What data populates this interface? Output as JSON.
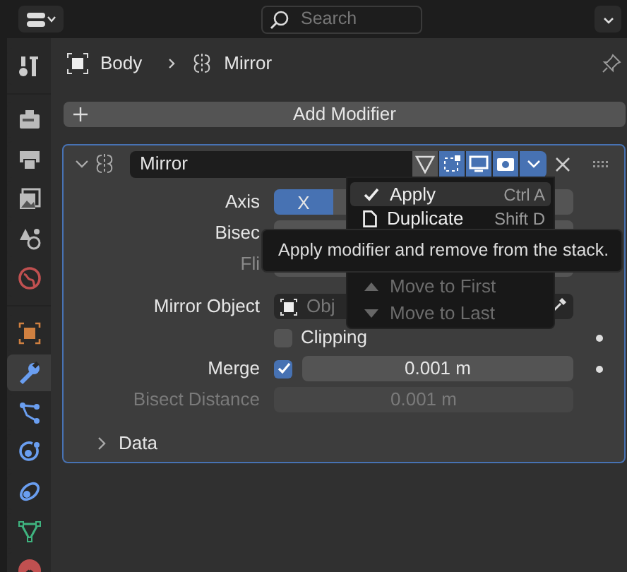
{
  "topbar": {
    "search": {
      "placeholder": "Search"
    }
  },
  "sidebar": [
    {
      "kind": "tool",
      "selected": false
    },
    {
      "kind": "render",
      "selected": false
    },
    {
      "kind": "output",
      "selected": false
    },
    {
      "kind": "view_layer",
      "selected": false
    },
    {
      "kind": "scene",
      "selected": false
    },
    {
      "kind": "world",
      "selected": false
    },
    {
      "kind": "object",
      "selected": false
    },
    {
      "kind": "modifier",
      "selected": true
    },
    {
      "kind": "particles",
      "selected": false
    },
    {
      "kind": "physics",
      "selected": false
    },
    {
      "kind": "constraints",
      "selected": false
    },
    {
      "kind": "data",
      "selected": false
    },
    {
      "kind": "material",
      "selected": false
    }
  ],
  "breadcrumb": [
    "Body",
    "Mirror"
  ],
  "add_button": "Add Modifier",
  "modifier": {
    "name": "Mirror",
    "expanded": true,
    "toggles": [
      {
        "kind": "cage",
        "on": false
      },
      {
        "kind": "edit_mode",
        "on": true
      },
      {
        "kind": "viewport",
        "on": true
      },
      {
        "kind": "render",
        "on": true
      }
    ],
    "axis": {
      "label": "Axis",
      "options": [
        {
          "label": "X",
          "selected": true
        }
      ]
    },
    "bisect_label": "Bisec",
    "flip_label": "Fli",
    "mirror_object": {
      "label": "Mirror Object",
      "placeholder": "Obj"
    },
    "clipping": {
      "label": "Clipping",
      "checked": false
    },
    "merge": {
      "label": "Merge",
      "checked": true,
      "value": "0.001 m"
    },
    "bisect_distance": {
      "label": "Bisect Distance",
      "value": "0.001 m",
      "disabled": true
    },
    "data": {
      "label": "Data",
      "expanded": false
    }
  },
  "context_menu": [
    {
      "kind": "check",
      "label": "Apply",
      "shortcut": "Ctrl A",
      "selected": true,
      "disabled": false
    },
    {
      "kind": "copy",
      "label": "Duplicate",
      "shortcut": "Shift D",
      "selected": false,
      "disabled": false
    },
    {
      "kind": "up",
      "label": "Move to First",
      "selected": false,
      "disabled": true
    },
    {
      "kind": "down",
      "label": "Move to Last",
      "selected": false,
      "disabled": true
    }
  ],
  "tooltip": "Apply modifier and remove from the stack."
}
